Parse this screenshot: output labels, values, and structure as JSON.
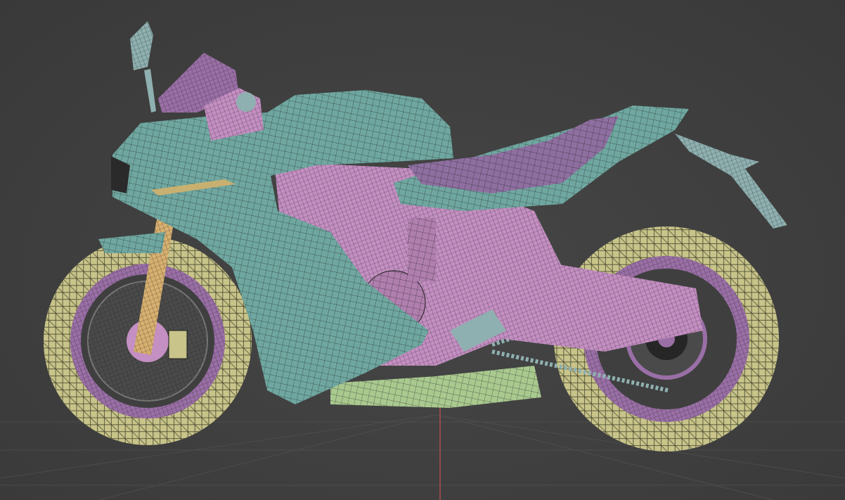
{
  "viewport": {
    "background": "#3f3f3f",
    "grid_line_color": "#555555",
    "axis_z_color": "#c85050"
  },
  "model": {
    "subject": "motorcycle-wireframe",
    "view": "side",
    "material_colors": {
      "fairing": "#6fa7a0",
      "frame": "#c48fc2",
      "tire": "#c8c48a",
      "rim": "#9a6fa6",
      "seat": "#8e6fa0",
      "exhaust": "#a9c98f",
      "disc": "#4a4a4a",
      "wire": "#1c1c1c"
    }
  }
}
